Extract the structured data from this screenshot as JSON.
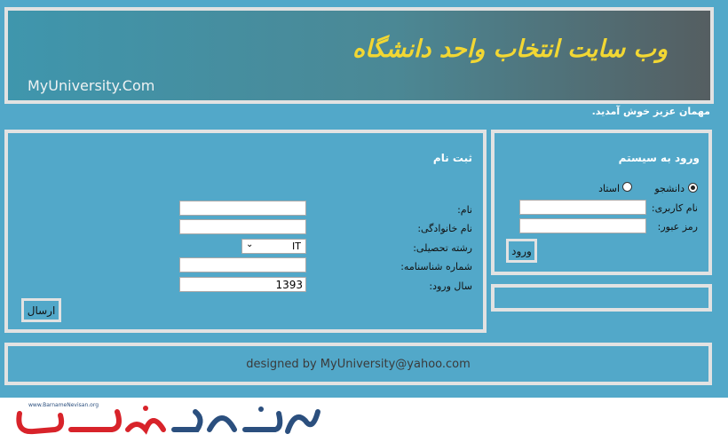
{
  "header": {
    "title": "وب سایت انتخاب واحد دانشگاه",
    "site_name": "MyUniversity.Com"
  },
  "welcome": "مهمان عزیز خوش آمدید.",
  "login": {
    "title": "ورود به سیستم",
    "radio_student": "دانشجو",
    "radio_teacher": "استاد",
    "username_label": "نام کاربری:",
    "password_label": "رمز عبور:",
    "submit_label": "ورود"
  },
  "register": {
    "title": "ثبت نام",
    "first_name_label": "نام:",
    "last_name_label": "نام خانوادگی:",
    "major_label": "رشته تحصیلی:",
    "major_value": "IT",
    "id_label": "شماره شناسنامه:",
    "entry_year_label": "سال ورود:",
    "entry_year_value": "1393",
    "submit_label": "ارسال"
  },
  "footer": {
    "text": "designed by MyUniversity@yahoo.com"
  },
  "watermark": {
    "url": "www.BarnameNevisan.org",
    "logo_text": "برنامه نویسان"
  },
  "colors": {
    "background": "#52a8c9",
    "border": "#e2e2e2",
    "title_yellow": "#f2d733",
    "logo_red": "#d8232a",
    "logo_blue": "#2b4f7e"
  }
}
